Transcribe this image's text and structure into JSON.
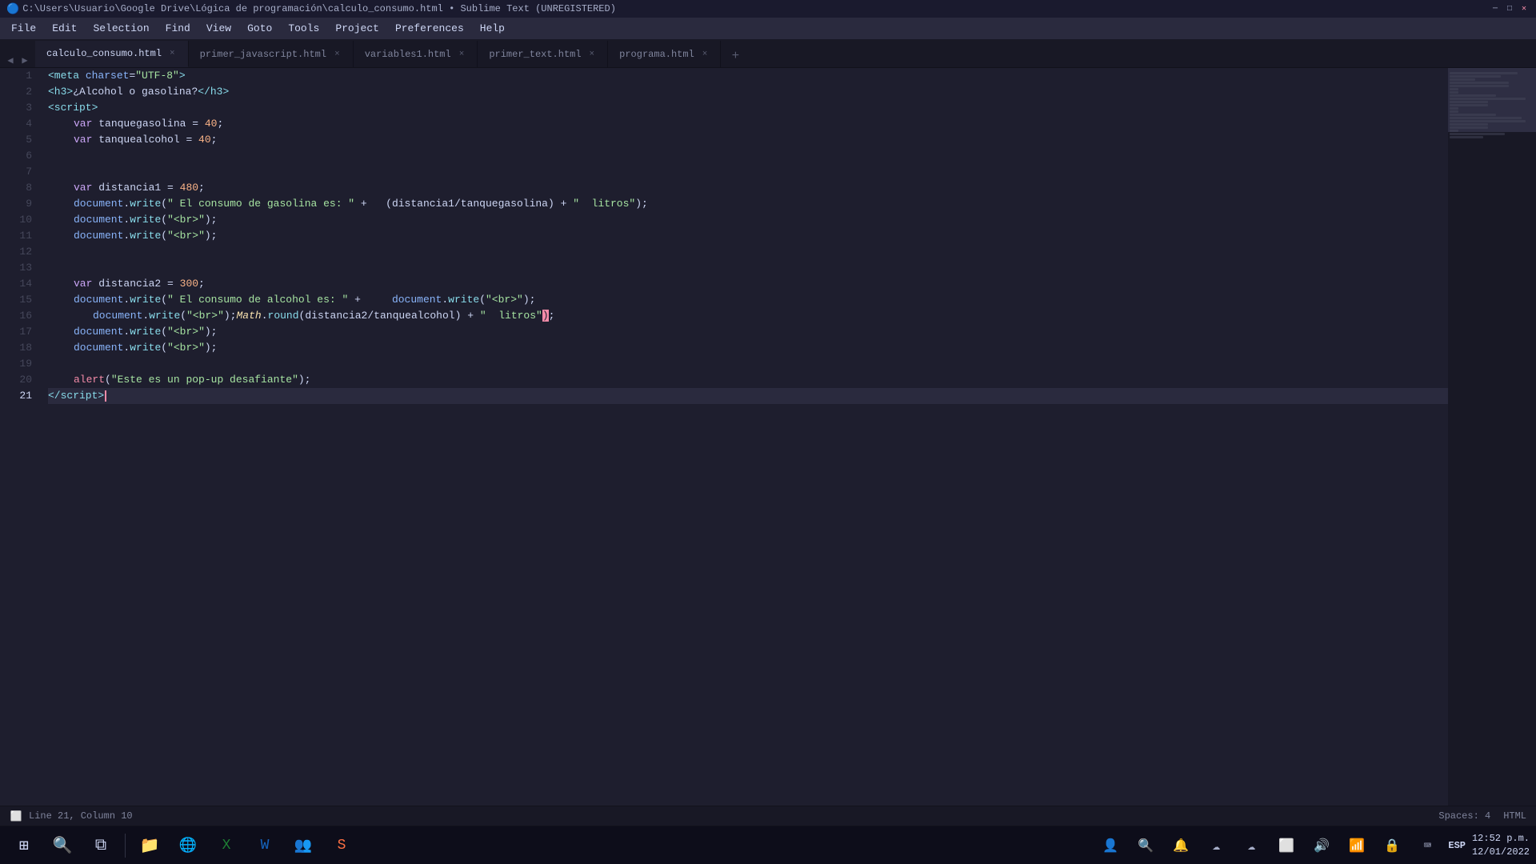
{
  "titlebar": {
    "title": "C:\\Users\\Usuario\\Google Drive\\Lógica de programación\\calculo_consumo.html • Sublime Text (UNREGISTERED)"
  },
  "menubar": {
    "items": [
      "File",
      "Edit",
      "Selection",
      "Find",
      "View",
      "Goto",
      "Tools",
      "Project",
      "Preferences",
      "Help"
    ]
  },
  "tabs": [
    {
      "label": "calculo_consumo.html",
      "active": true,
      "has_close": true,
      "modified": true
    },
    {
      "label": "primer_javascript.html",
      "active": false,
      "has_close": true,
      "modified": false
    },
    {
      "label": "variables1.html",
      "active": false,
      "has_close": true,
      "modified": false
    },
    {
      "label": "primer_text.html",
      "active": false,
      "has_close": true,
      "modified": false
    },
    {
      "label": "programa.html",
      "active": false,
      "has_close": true,
      "modified": false
    }
  ],
  "statusbar": {
    "position": "Line 21, Column 10",
    "spaces": "Spaces: 4",
    "language": "HTML"
  },
  "taskbar": {
    "clock": "12:52 p.m.\n12/01/2022",
    "lang": "ESP"
  }
}
